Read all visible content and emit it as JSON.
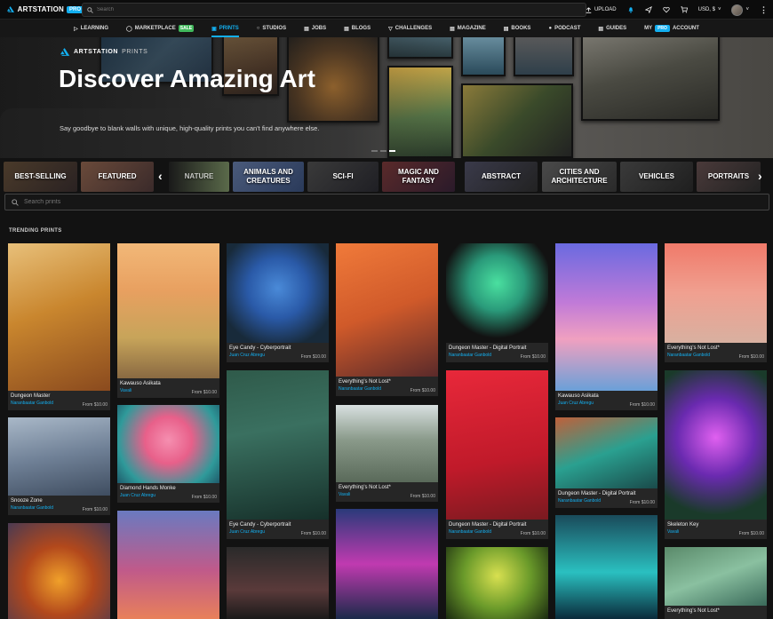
{
  "topbar": {
    "logo_text": "ARTSTATION",
    "pro_badge": "PRO",
    "search_placeholder": "Search",
    "upload_label": "UPLOAD",
    "currency_label": "USD, $"
  },
  "nav": {
    "items": [
      {
        "label": "LEARNING"
      },
      {
        "label": "MARKETPLACE",
        "badge": "SALE"
      },
      {
        "label": "PRINTS"
      },
      {
        "label": "STUDIOS"
      },
      {
        "label": "JOBS"
      },
      {
        "label": "BLOGS"
      },
      {
        "label": "CHALLENGES"
      },
      {
        "label": "MAGAZINE"
      },
      {
        "label": "BOOKS"
      },
      {
        "label": "PODCAST"
      },
      {
        "label": "GUIDES"
      }
    ],
    "account_prefix": "MY",
    "account_badge": "PRO",
    "account_suffix": "ACCOUNT"
  },
  "hero": {
    "brand": "ARTSTATION",
    "brand_suffix": "PRINTS",
    "title": "Discover Amazing Art",
    "subtitle": "Say goodbye to blank walls with unique, high-quality prints you can't find anywhere else."
  },
  "categories": [
    "BEST-SELLING",
    "FEATURED",
    "NATURE",
    "ANIMALS AND CREATURES",
    "SCI-FI",
    "MAGIC AND FANTASY",
    "ABSTRACT",
    "CITIES AND ARCHITECTURE",
    "VEHICLES",
    "PORTRAITS"
  ],
  "search_prints_placeholder": "Search prints",
  "trending_label": "TRENDING PRINTS",
  "cards": [
    {
      "title": "Dungeon Master",
      "artist": "Naranbaatar Ganbold",
      "price": "From $10.00"
    },
    {
      "title": "Snooze Zone",
      "artist": "Naranbaatar Ganbold",
      "price": "From $10.00"
    },
    {
      "title": "Kawauso Asikata",
      "artist": "Vavali",
      "price": "From $10.00"
    },
    {
      "title": "Diamond Hands Monke",
      "artist": "Juan Cruz Abregu",
      "price": "From $10.00"
    },
    {
      "title": "Eye Candy - Cyberportrait",
      "artist": "Juan Cruz Abregu",
      "price": "From $10.00"
    },
    {
      "title": "Eye Candy - Cyberportrait",
      "artist": "Juan Cruz Abregu",
      "price": "From $10.00"
    },
    {
      "title": "Everything's Not Lost*",
      "artist": "Naranbaatar Ganbold",
      "price": "From $10.00"
    },
    {
      "title": "Everything's Not Lost*",
      "artist": "Vavali",
      "price": "From $10.00"
    },
    {
      "title": "Dungeon Master - Digital Portrait",
      "artist": "Naranbaatar Ganbold",
      "price": "From $10.00"
    },
    {
      "title": "Dungeon Master - Digital Portrait",
      "artist": "Naranbaatar Ganbold",
      "price": "From $10.00"
    },
    {
      "title": "Kawauso Asikata",
      "artist": "Juan Cruz Abregu",
      "price": "From $10.00"
    },
    {
      "title": "Dungeon Master - Digital Portrait",
      "artist": "Naranbaatar Ganbold",
      "price": "From $10.00"
    },
    {
      "title": "Everything's Not Lost*",
      "artist": "Naranbaatar Ganbold",
      "price": "From $10.00"
    },
    {
      "title": "Skeleton Key",
      "artist": "Vavali",
      "price": "From $10.00"
    },
    {
      "title": "Everything's Not Lost*",
      "artist": "",
      "price": ""
    }
  ]
}
